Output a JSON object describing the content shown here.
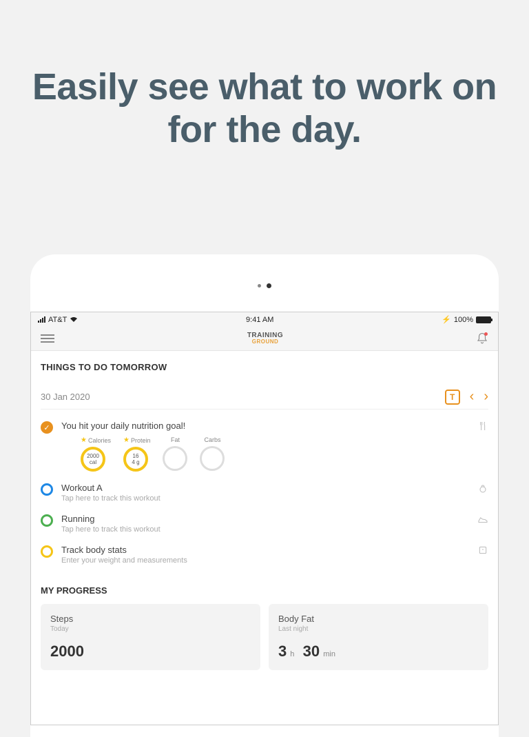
{
  "headline": "Easily see what to work on for the day.",
  "status": {
    "carrier": "AT&T",
    "time": "9:41 AM",
    "battery": "100%"
  },
  "app": {
    "logo_top": "TRAINING",
    "logo_bottom": "GROUND"
  },
  "things": {
    "title": "THINGS TO DO TOMORROW",
    "date": "30 Jan 2020",
    "today_btn": "T"
  },
  "nutrition": {
    "title": "You hit your daily nutrition goal!",
    "items": [
      {
        "label": "Calories",
        "value": "2000",
        "unit": "cal",
        "starred": true,
        "filled": true
      },
      {
        "label": "Protein",
        "value": "16",
        "unit": "4 g",
        "starred": true,
        "filled": true
      },
      {
        "label": "Fat",
        "value": "",
        "unit": "",
        "starred": false,
        "filled": false
      },
      {
        "label": "Carbs",
        "value": "",
        "unit": "",
        "starred": false,
        "filled": false
      }
    ]
  },
  "tasks": [
    {
      "title": "Workout A",
      "sub": "Tap here to track this workout",
      "ring": "blue",
      "icon": "kettlebell"
    },
    {
      "title": "Running",
      "sub": "Tap here to track this workout",
      "ring": "green",
      "icon": "shoe"
    },
    {
      "title": "Track body stats",
      "sub": "Enter your weight and measurements",
      "ring": "yellow",
      "icon": "scale"
    }
  ],
  "progress": {
    "title": "MY PROGRESS",
    "cards": [
      {
        "title": "Steps",
        "sub": "Today",
        "value": "2000",
        "unit": ""
      },
      {
        "title": "Body Fat",
        "sub": "Last night",
        "value": "3",
        "unit": "h",
        "value2": "30",
        "unit2": "min"
      }
    ]
  }
}
